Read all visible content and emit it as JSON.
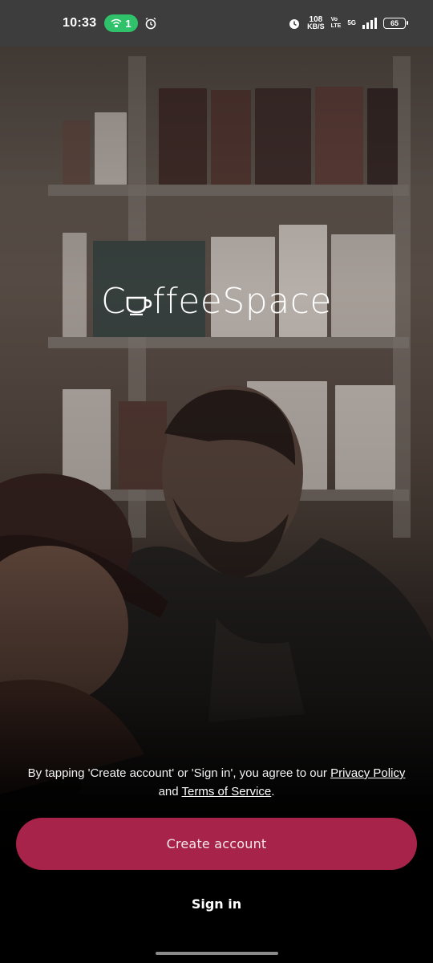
{
  "status_bar": {
    "time": "10:33",
    "hotspot_count": "1",
    "speed_value": "108",
    "speed_unit": "KB/S",
    "volte_top": "Vo",
    "volte_bottom": "LTE",
    "network": "5G",
    "battery": "65",
    "icons": [
      "hotspot-icon",
      "alarm-icon",
      "alarm-icon",
      "signal-icon",
      "battery-icon"
    ]
  },
  "brand": {
    "logo_left": "C",
    "logo_right": "ffeeSpace",
    "logo_full": "CoffeeSpace"
  },
  "consent": {
    "prefix": "By tapping 'Create account' or 'Sign in', you agree to our ",
    "privacy_link": "Privacy Policy",
    "middle": " and ",
    "terms_link": "Terms of Service",
    "suffix": "."
  },
  "actions": {
    "create_account": "Create account",
    "sign_in": "Sign in"
  },
  "colors": {
    "primary": "#a8234a",
    "hotspot": "#2fc26b",
    "status_bar": "#3d3d3d"
  }
}
